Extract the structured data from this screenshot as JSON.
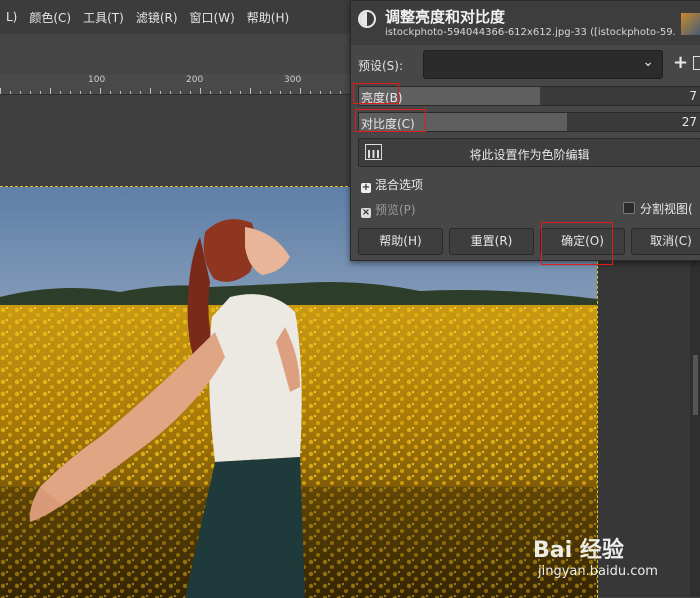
{
  "menubar": {
    "items": [
      "L)",
      "颜色(C)",
      "工具(T)",
      "滤镜(R)",
      "窗口(W)",
      "帮助(H)"
    ]
  },
  "ruler": {
    "labels": [
      "100",
      "200",
      "300"
    ]
  },
  "dialog": {
    "title": "调整亮度和对比度",
    "subtitle": "istockphoto-594044366-612x612.jpg-33 ([istockphoto-59...",
    "preset_label": "预设(S):",
    "preset_value": "",
    "brightness": {
      "label": "亮度(B)",
      "value": "7",
      "fraction": 0.53
    },
    "contrast": {
      "label": "对比度(C)",
      "value": "27",
      "fraction": 0.61
    },
    "levels_button": "将此设置作为色阶编辑",
    "blend_options": "混合选项",
    "preview": "预览(P)",
    "split_view": "分割视图(",
    "buttons": {
      "help": "帮助(H)",
      "reset": "重置(R)",
      "ok": "确定(O)",
      "cancel": "取消(C)"
    }
  },
  "watermark": {
    "logo": "Bai 经验",
    "url": "jingyan.baidu.com"
  },
  "colors": {
    "highlight": "#e01b1b",
    "selection": "#e3c51a"
  }
}
